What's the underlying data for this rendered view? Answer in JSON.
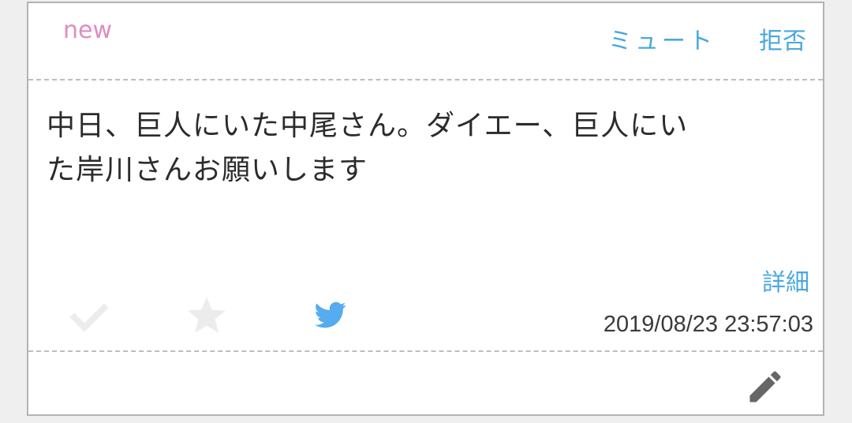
{
  "card": {
    "new_label": "new",
    "mute_label": "ミュート",
    "reject_label": "拒否",
    "message_line1": "中日、巨人にいた中尾さん。ダイエー、巨人にい",
    "message_line2": "た岸川さんお願いします",
    "detail_label": "詳細",
    "timestamp": "2019/08/23 23:57:03"
  },
  "icons": {
    "check": "check-icon",
    "star": "star-icon",
    "twitter": "twitter-icon",
    "edit": "pencil-icon"
  },
  "colors": {
    "new_label": "#e08bc3",
    "link": "#4aa8df",
    "icon_inactive": "#ececec",
    "twitter": "#55acee",
    "pencil": "#666666",
    "border": "#b3b3b3"
  }
}
